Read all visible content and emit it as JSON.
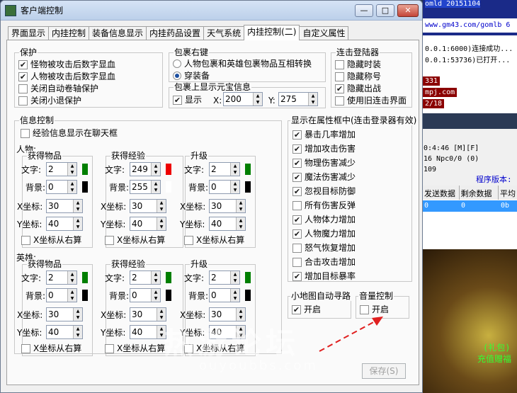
{
  "window": {
    "title": "客户端控制",
    "min": "—",
    "max": "□",
    "close": "✕"
  },
  "tabs": [
    "界面显示",
    "内挂控制",
    "装备信息显示",
    "内挂药品设置",
    "天气系统",
    "内挂控制(二)",
    "自定义属性"
  ],
  "protect": {
    "title": "保护",
    "items": [
      {
        "label": "怪物被攻击后数字显血",
        "checked": true
      },
      {
        "label": "人物被攻击后数字显血",
        "checked": true
      },
      {
        "label": "关闭自动卷轴保护",
        "checked": false
      },
      {
        "label": "关闭小退保护",
        "checked": false
      }
    ]
  },
  "bag_right": {
    "title": "包裹右键",
    "options": [
      {
        "label": "人物包裹和英雄包裹物品互相转换",
        "selected": false
      },
      {
        "label": "穿装备",
        "selected": true
      }
    ]
  },
  "bag_gold": {
    "title": "包裹上显示元宝信息",
    "show_label": "显示",
    "show_checked": true,
    "x_label": "X:",
    "x_value": "200",
    "y_label": "Y:",
    "y_value": "275"
  },
  "launcher": {
    "title": "连击登陆器",
    "items": [
      {
        "label": "隐藏时装",
        "checked": false
      },
      {
        "label": "隐藏称号",
        "checked": false
      },
      {
        "label": "隐藏出战",
        "checked": true
      },
      {
        "label": "使用旧连击界面",
        "checked": false
      }
    ]
  },
  "info": {
    "title": "信息控制",
    "exp_chat": "经验信息显示在聊天框",
    "exp_chat_checked": false,
    "person": "人物:",
    "hero": "英雄:"
  },
  "sub_labels": {
    "item": "获得物品",
    "exp": "获得经验",
    "level": "升级",
    "text": "文字:",
    "bg": "背景:",
    "x": "X坐标:",
    "y": "Y坐标:",
    "xr": "X坐标从右算"
  },
  "person_blocks": [
    {
      "text": "2",
      "bg": "0",
      "x": "30",
      "y": "40",
      "xr": false,
      "text_color": "#007f00",
      "bg_color": "#000000"
    },
    {
      "text": "249",
      "bg": "255",
      "x": "30",
      "y": "40",
      "xr": false,
      "text_color": "#ee0000",
      "bg_color": "#ffffff"
    },
    {
      "text": "2",
      "bg": "0",
      "x": "30",
      "y": "40",
      "xr": false,
      "text_color": "#007f00",
      "bg_color": "#000000"
    }
  ],
  "hero_blocks": [
    {
      "text": "2",
      "bg": "0",
      "x": "30",
      "y": "40",
      "xr": false,
      "text_color": "#007f00",
      "bg_color": "#000000"
    },
    {
      "text": "2",
      "bg": "0",
      "x": "30",
      "y": "40",
      "xr": false,
      "text_color": "#007f00",
      "bg_color": "#000000"
    },
    {
      "text": "2",
      "bg": "0",
      "x": "30",
      "y": "40",
      "xr": false,
      "text_color": "#007f00",
      "bg_color": "#000000"
    }
  ],
  "attr": {
    "title": "显示在属性框中(连击登录器有效)",
    "items": [
      {
        "label": "暴击几率增加",
        "checked": true
      },
      {
        "label": "增加攻击伤害",
        "checked": true
      },
      {
        "label": "物理伤害减少",
        "checked": true
      },
      {
        "label": "魔法伤害减少",
        "checked": true
      },
      {
        "label": "忽视目标防御",
        "checked": true
      },
      {
        "label": "所有伤害反弹",
        "checked": false
      },
      {
        "label": "人物体力增加",
        "checked": true
      },
      {
        "label": "人物魔力增加",
        "checked": true
      },
      {
        "label": "怒气恢复增加",
        "checked": false
      },
      {
        "label": "合击攻击增加",
        "checked": false
      },
      {
        "label": "增加目标暴率",
        "checked": true
      }
    ]
  },
  "minimap": {
    "title": "小地图自动寻路",
    "label": "开启",
    "checked": true
  },
  "volume": {
    "title": "音量控制",
    "label": "开启",
    "checked": false
  },
  "save_label": "保存(S)",
  "watermark": "热游论坛",
  "watermark_url": "ouyoubbs.com",
  "bg_texts": [
    "omld 20151104",
    "www.gm43.com/gomlb 6",
    "0.0.1:6000)连接成功...",
    "0.0.1:53736)已打开...",
    "331",
    "mpj.com",
    "2/18",
    "0:4:46 [M][F]",
    "16 Npc0/0 (0)",
    "109",
    "程序版本:",
    "发送数据",
    "剩余数据",
    "平均",
    "0",
    "0",
    "0b",
    "(礼包)",
    "充值赠福"
  ],
  "colors": {
    "checked": "#1c4fa0"
  }
}
